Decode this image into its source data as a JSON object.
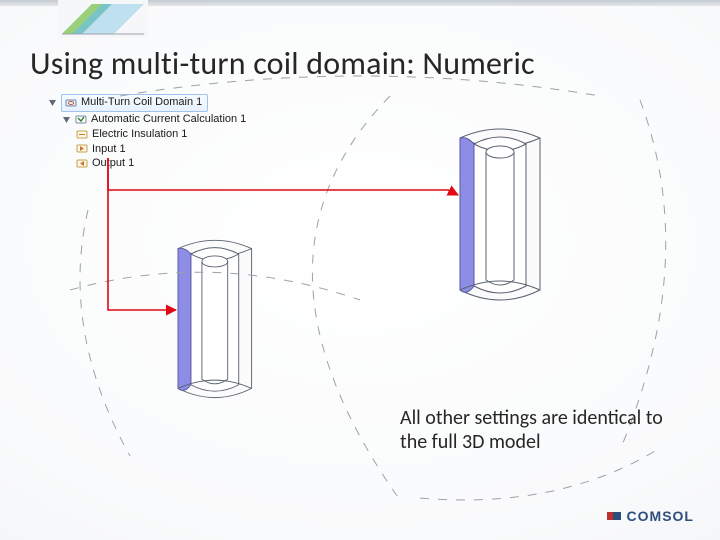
{
  "title": "Using multi-turn coil domain: Numeric",
  "tree": {
    "root": "Multi-Turn Coil Domain 1",
    "child": "Automatic Current Calculation 1",
    "leaves": [
      "Electric Insulation 1",
      "Input 1",
      "Output 1"
    ]
  },
  "note": "All other settings are identical to the full 3D model",
  "brand": "COMSOL"
}
